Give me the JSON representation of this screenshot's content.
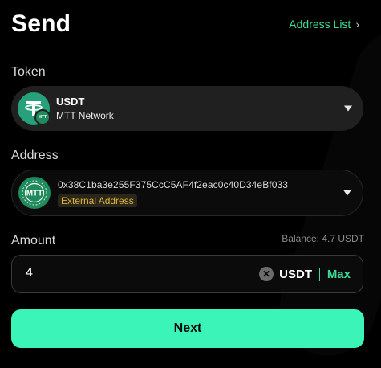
{
  "header": {
    "title": "Send",
    "address_list_label": "Address List"
  },
  "token": {
    "label": "Token",
    "name": "USDT",
    "network": "MTT Network",
    "badge": "MTT",
    "icon": "tether-icon"
  },
  "address": {
    "label": "Address",
    "value": "0x38C1ba3e255F375CcC5AF4f2eac0c40D34eBf033",
    "tag": "External Address",
    "icon": "mtt-network-icon"
  },
  "amount": {
    "label": "Amount",
    "balance": "Balance: 4.7 USDT",
    "value": "4",
    "unit": "USDT",
    "max_label": "Max"
  },
  "actions": {
    "next_label": "Next"
  },
  "colors": {
    "accent": "#3ddc97",
    "button": "#3af5b7",
    "tag": "#e0b341",
    "tether": "#26a17b"
  }
}
